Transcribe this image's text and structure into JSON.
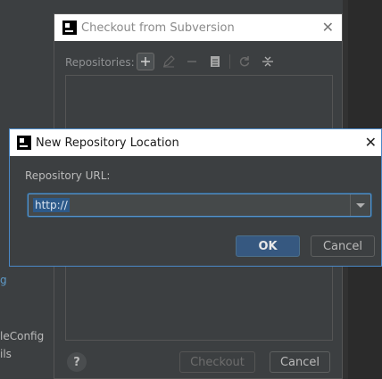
{
  "background": {
    "left_texts": [
      "g",
      "leConfig",
      "ils"
    ]
  },
  "back_dialog": {
    "title": "Checkout from Subversion",
    "close_glyph": "✕",
    "repositories_label": "Repositories:",
    "toolbar_icons": [
      "plus-icon",
      "edit-icon",
      "minus-icon",
      "clipboard-icon",
      "refresh-icon",
      "collapse-icon"
    ],
    "help_glyph": "?",
    "checkout_label": "Checkout",
    "cancel_label": "Cancel"
  },
  "front_dialog": {
    "title": "New Repository Location",
    "close_glyph": "✕",
    "url_label": "Repository URL:",
    "url_value": "http://",
    "ok_label": "OK",
    "cancel_label": "Cancel"
  },
  "colors": {
    "accent": "#4a88c7",
    "primary_button": "#365880",
    "background": "#3c3f41"
  }
}
